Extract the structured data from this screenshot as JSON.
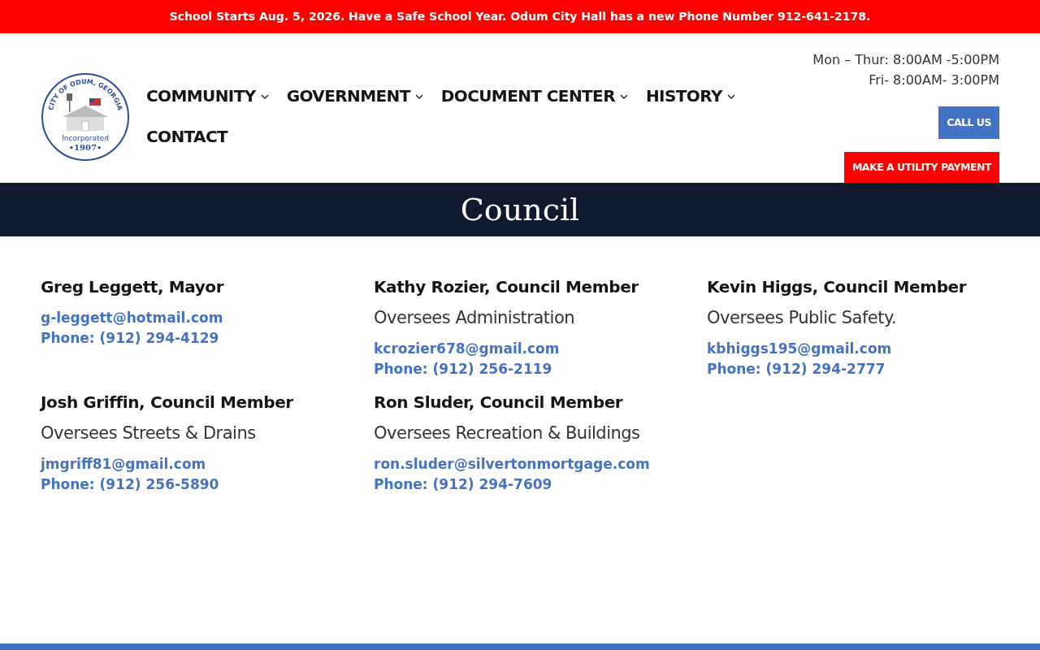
{
  "announcement": "School Starts Aug. 5, 2026. Have a Safe School Year. Odum City Hall has a new Phone Number 912-641-2178.",
  "logo": {
    "ring_text": "CITY OF ODUM, GEORGIA",
    "banner": "Incorporated",
    "year": "•1907•"
  },
  "nav": [
    {
      "label": "COMMUNITY",
      "dropdown": true
    },
    {
      "label": "GOVERNMENT",
      "dropdown": true
    },
    {
      "label": "DOCUMENT CENTER",
      "dropdown": true
    },
    {
      "label": "HISTORY",
      "dropdown": true
    },
    {
      "label": "CONTACT",
      "dropdown": false
    }
  ],
  "hours": [
    "Mon – Thur: 8:00AM -5:00PM",
    "Fri- 8:00AM- 3:00PM"
  ],
  "buttons": [
    {
      "label": "CALL US",
      "kind": "primary"
    },
    {
      "label": "MAKE A UTILITY PAYMENT",
      "kind": "alert"
    }
  ],
  "page_title": "Council",
  "members": [
    {
      "name": "Greg Leggett, Mayor",
      "email": "g-leggett@hotmail.com",
      "phone": "Phone: (912) 294-4129"
    },
    {
      "name": "Kathy Rozier, Council Member",
      "role": "Oversees Administration",
      "email": "kcrozier678@gmail.com",
      "phone": "Phone: (912) 256-2119"
    },
    {
      "name": "Kevin Higgs, Council Member",
      "role": "Oversees Public Safety.",
      "email": "kbhiggs195@gmail.com",
      "phone": "Phone: (912) 294-2777"
    },
    {
      "name": "Josh Griffin, Council Member",
      "role": "Oversees Streets & Drains",
      "email": "jmgriff81@gmail.com",
      "phone": "Phone: (912) 256-5890"
    },
    {
      "name": "Ron Sluder, Council Member",
      "role": "Oversees Recreation & Buildings",
      "email": "ron.sluder@silvertonmortgage.com",
      "phone": "Phone: (912) 294-7609"
    }
  ]
}
